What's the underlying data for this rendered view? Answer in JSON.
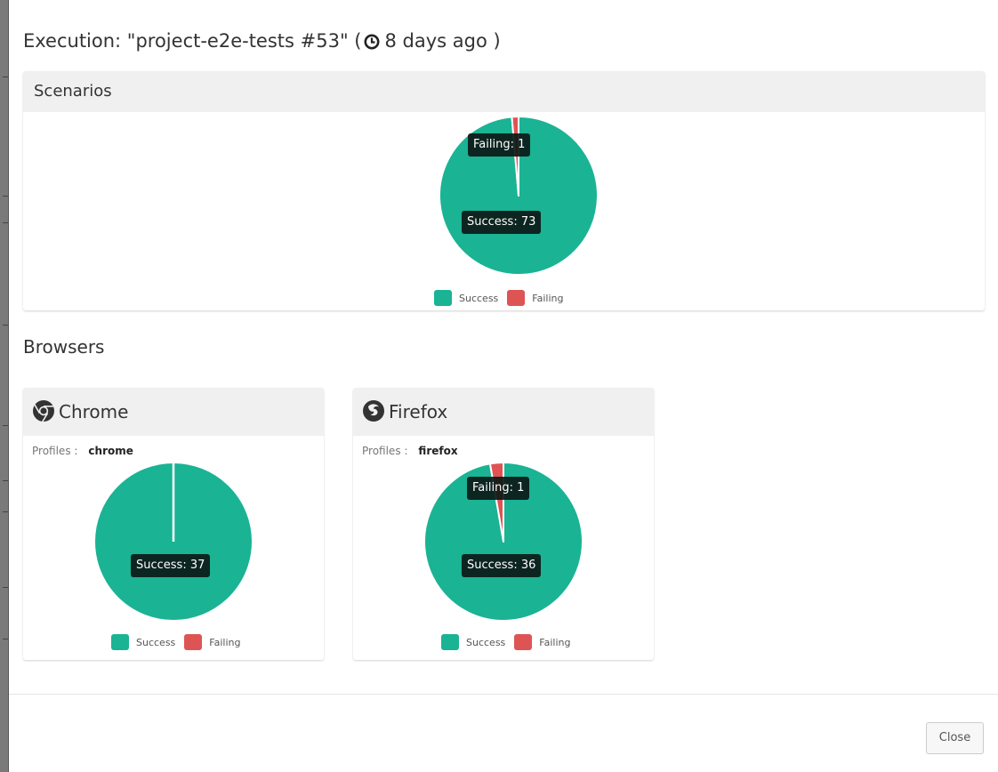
{
  "modal": {
    "title_prefix": "Execution: \"project-e2e-tests #53\" (",
    "time_ago": "8 days ago )",
    "close_label": "Close"
  },
  "colors": {
    "success": "#1ab394",
    "failing": "#de5454"
  },
  "scenarios": {
    "title": "Scenarios",
    "chart_data": {
      "type": "pie",
      "labels": [
        "Success",
        "Failing"
      ],
      "values": [
        73,
        1
      ],
      "tooltips": [
        "Success: 73",
        "Failing: 1"
      ],
      "legend": [
        "Success",
        "Failing"
      ],
      "legend_position": "bottom"
    }
  },
  "browsers": {
    "title": "Browsers",
    "profiles_label": "Profiles :",
    "items": [
      {
        "name": "Chrome",
        "icon": "chrome-icon",
        "profile": "chrome",
        "chart_data": {
          "type": "pie",
          "labels": [
            "Success",
            "Failing"
          ],
          "values": [
            37,
            0
          ],
          "tooltips": [
            "Success: 37"
          ],
          "legend": [
            "Success",
            "Failing"
          ],
          "legend_position": "bottom"
        }
      },
      {
        "name": "Firefox",
        "icon": "firefox-icon",
        "profile": "firefox",
        "chart_data": {
          "type": "pie",
          "labels": [
            "Success",
            "Failing"
          ],
          "values": [
            36,
            1
          ],
          "tooltips": [
            "Success: 36",
            "Failing: 1"
          ],
          "legend": [
            "Success",
            "Failing"
          ],
          "legend_position": "bottom"
        }
      }
    ]
  }
}
